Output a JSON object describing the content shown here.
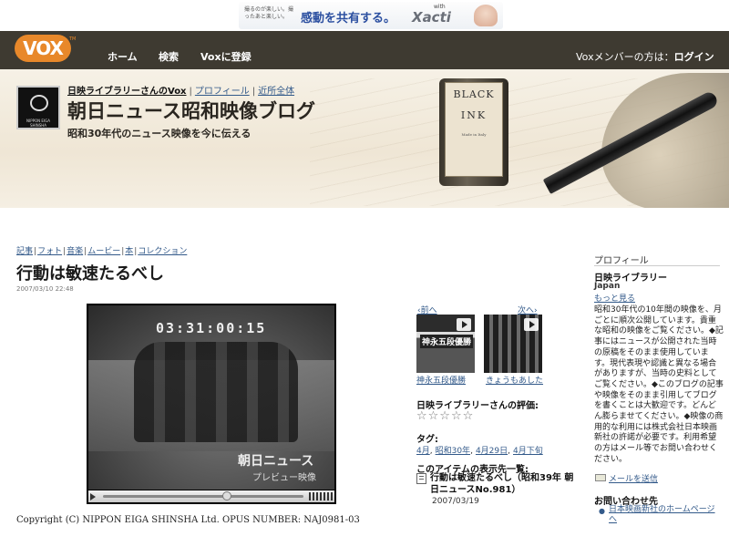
{
  "ad": {
    "small_text": "撮るのが楽しい。撮ったあと楽しい。",
    "main_text": "感動を共有する。",
    "with_text": "with",
    "brand": "Xacti"
  },
  "nav": {
    "logo": "VOX",
    "logo_tm": "TM",
    "home": "ホーム",
    "search": "検索",
    "register": "Voxに登録",
    "member_prefix": "Voxメンバーの方は：",
    "login": "ログイン"
  },
  "header": {
    "avatar_text": "NIPPON EIGA SHINSHA",
    "owner_link": "日映ライブラリーさんのVox",
    "profile_link": "プロフィール",
    "neighborhood_link": "近所全体",
    "title": "朝日ニュース昭和映像ブログ",
    "subtitle": "昭和30年代のニュース映像を今に伝える",
    "bottle_line1": "BLACK",
    "bottle_line2": "INK",
    "bottle_small": "Made in Italy"
  },
  "post": {
    "categories": [
      "記事",
      "フォト",
      "音楽",
      "ムービー",
      "本",
      "コレクション"
    ],
    "title": "行動は敏速たるべし",
    "date": "2007/03/10 22:48",
    "timecode": "03:31:00:15",
    "watermark1": "朝日ニュース",
    "watermark2": "プレビュー映像",
    "seek_fraction": 0.62,
    "copyright": "Copyright (C) NIPPON EIGA SHINSHA Ltd. OPUS NUMBER: NAJ0981-03"
  },
  "related": {
    "prev": "‹前へ",
    "next": "次へ›",
    "thumb1_tag": "神永五段優勝",
    "thumb1_caption": "神永五段優勝",
    "thumb2_caption": "きょうもあした"
  },
  "rating": {
    "label": "日映ライブラリーさんの評価:",
    "stars": "☆☆☆☆☆",
    "value": 0
  },
  "tags": {
    "label": "タグ:",
    "items": [
      "4月",
      "昭和30年",
      "4月29日",
      "4月下旬"
    ]
  },
  "listing": {
    "label": "このアイテムの表示先一覧:",
    "item": "行動は敏速たるべし（昭和39年 朝日ニュースNo.981）",
    "date": "2007/03/19"
  },
  "sidebar": {
    "heading": "プロフィール",
    "name": "日映ライブラリー",
    "country": "Japan",
    "more": "もっと見る",
    "bio": "昭和30年代の10年間の映像を、月ごとに順次公開しています。貴重な昭和の映像をご覧ください。◆記事にはニュースが公開された当時の原稿をそのまま使用しています。現代表現や認識と異なる場合がありますが、当時の史料としてご覧ください。◆このブログの記事や映像をそのまま引用してブログを書くことは大歓迎です。どんどん膨らませてください。◆映像の商用的な利用には株式会社日本映画新社の許諾が必要です。利用希望の方はメール等でお問い合わせください。",
    "mail": "メールを送信",
    "contact_heading": "お問い合わせ先",
    "contact_link": "日本映画新社のホームページへ"
  }
}
